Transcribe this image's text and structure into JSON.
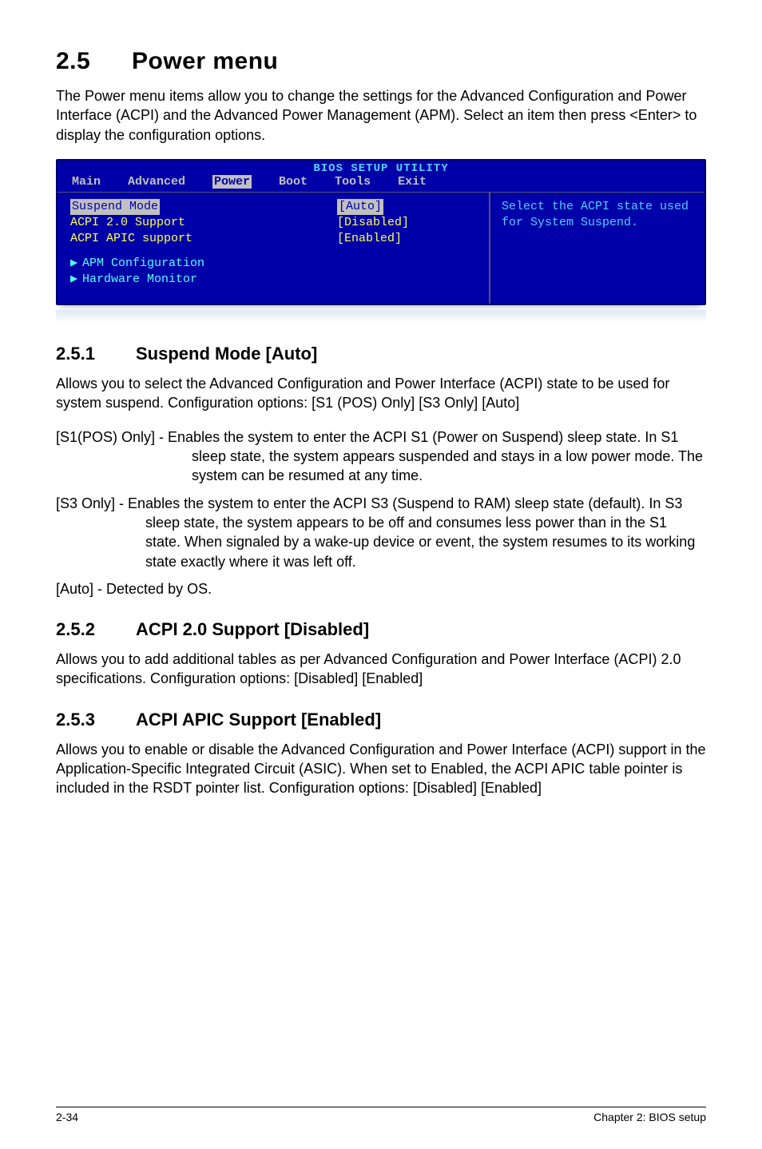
{
  "section": {
    "number": "2.5",
    "title": "Power menu",
    "intro": "The Power menu items allow you to change the settings for the Advanced Configuration and Power Interface (ACPI) and the Advanced Power Management (APM). Select an item then press <Enter> to display the configuration options."
  },
  "bios": {
    "title": "BIOS SETUP UTILITY",
    "tabs": [
      "Main",
      "Advanced",
      "Power",
      "Boot",
      "Tools",
      "Exit"
    ],
    "active_tab": "Power",
    "left": {
      "items": [
        {
          "label": "Suspend Mode",
          "value": "[Auto]",
          "highlight": true
        },
        {
          "label": "ACPI 2.0 Support",
          "value": "[Disabled]"
        },
        {
          "label": "ACPI APIC support",
          "value": "[Enabled]"
        }
      ],
      "subitems": [
        "APM Configuration",
        "Hardware Monitor"
      ]
    },
    "help": "Select the ACPI state used for System Suspend."
  },
  "sub1": {
    "num": "2.5.1",
    "title": "Suspend Mode [Auto]",
    "p1": "Allows you to select the Advanced Configuration and Power Interface (ACPI) state to be used for system suspend. Configuration options: [S1 (POS) Only] [S3 Only] [Auto]",
    "h1_lead": "[S1(POS) Only] - ",
    "h1_body": "Enables the system to enter the ACPI S1 (Power on Suspend) sleep state. In S1 sleep state, the system appears suspended and stays in a low power mode. The system can be resumed at any time.",
    "h2_lead": "[S3 Only] - ",
    "h2_body": "Enables the system to enter the ACPI S3 (Suspend to RAM) sleep state (default). In S3 sleep state, the system appears to be off and consumes less power than in the S1 state. When signaled by a wake-up device or event, the system resumes to its working state exactly where it was left off.",
    "p2": "[Auto] - Detected by OS."
  },
  "sub2": {
    "num": "2.5.2",
    "title": "ACPI 2.0 Support [Disabled]",
    "p": "Allows you to add additional tables as per Advanced Configuration and Power Interface (ACPI) 2.0 specifications. Configuration options: [Disabled] [Enabled]"
  },
  "sub3": {
    "num": "2.5.3",
    "title": "ACPI APIC Support [Enabled]",
    "p": "Allows you to enable or disable the Advanced Configuration and Power Interface (ACPI) support in the Application-Specific Integrated Circuit (ASIC). When set to Enabled, the ACPI APIC table pointer is included in the RSDT pointer list. Configuration options: [Disabled] [Enabled]"
  },
  "footer": {
    "left": "2-34",
    "right": "Chapter 2: BIOS setup"
  }
}
